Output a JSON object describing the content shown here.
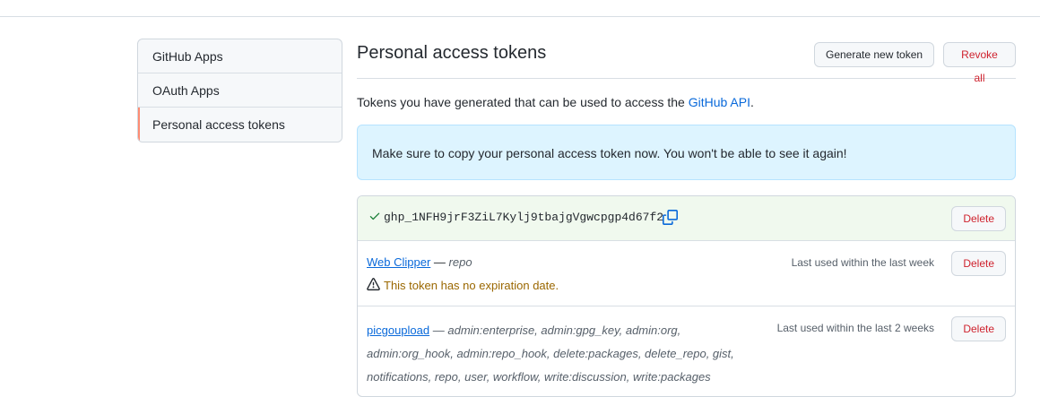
{
  "sidebar": {
    "items": [
      {
        "label": "GitHub Apps"
      },
      {
        "label": "OAuth Apps"
      },
      {
        "label": "Personal access tokens"
      }
    ]
  },
  "header": {
    "title": "Personal access tokens",
    "generate_label": "Generate new token",
    "revoke_label": "Revoke all"
  },
  "description": {
    "prefix": "Tokens you have generated that can be used to access the ",
    "link": "GitHub API",
    "suffix": "."
  },
  "flash": {
    "message": "Make sure to copy your personal access token now. You won't be able to see it again!"
  },
  "new_token": {
    "value": "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",
    "delete_label": "Delete"
  },
  "tokens": [
    {
      "name": "Web Clipper",
      "separator": " — ",
      "scopes": "repo",
      "last_used": "Last used within the last week",
      "warning": "This token has no expiration date.",
      "delete_label": "Delete"
    },
    {
      "name": "picgoupload",
      "separator": " — ",
      "scopes": "admin:enterprise, admin:gpg_key, admin:org, admin:org_hook, admin:repo_hook, delete:packages, delete_repo, gist, notifications, repo, user, workflow, write:discussion, write:packages",
      "last_used": "Last used within the last 2 weeks",
      "delete_label": "Delete"
    }
  ],
  "colors": {
    "link": "#0969da",
    "danger": "#cf222e",
    "success": "#1a7f37",
    "warning": "#9a6700",
    "active_marker": "#fd8c73"
  }
}
